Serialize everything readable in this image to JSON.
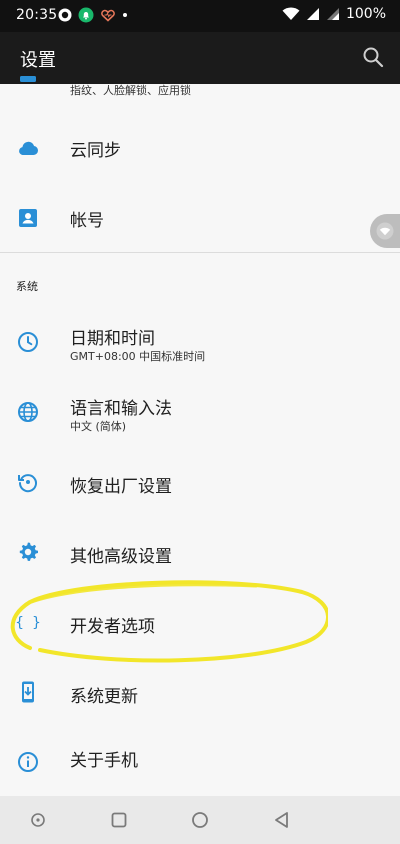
{
  "status_bar": {
    "time": "20:35",
    "battery": "100%"
  },
  "app_bar": {
    "title": "设置"
  },
  "items": {
    "security": {
      "subtitle": "指纹、人脸解锁、应用锁"
    },
    "cloud_sync": {
      "label": "云同步"
    },
    "account": {
      "label": "帐号"
    },
    "datetime": {
      "label": "日期和时间",
      "subtitle": "GMT+08:00 中国标准时间"
    },
    "language": {
      "label": "语言和输入法",
      "subtitle": "中文 (简体)"
    },
    "reset": {
      "label": "恢复出厂设置"
    },
    "advanced": {
      "label": "其他高级设置"
    },
    "developer": {
      "label": "开发者选项"
    },
    "update": {
      "label": "系统更新"
    },
    "about": {
      "label": "关于手机"
    }
  },
  "sections": {
    "system": "系统"
  },
  "colors": {
    "accent": "#2a8fd6",
    "highlight": "#f2e62a"
  }
}
